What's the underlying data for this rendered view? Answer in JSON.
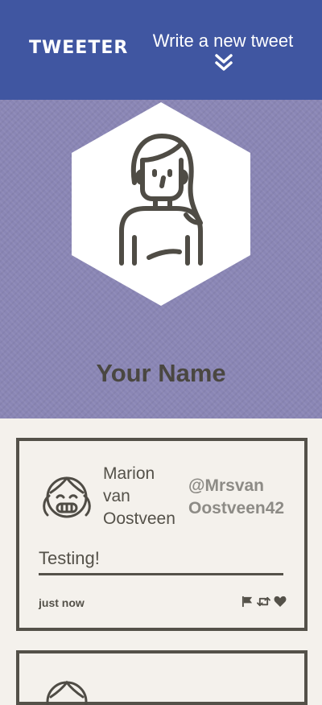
{
  "nav": {
    "brand": "TWEETER",
    "write_label": "Write a new tweet",
    "write_icon": "double-chevron-down-icon"
  },
  "profile": {
    "name": "Your Name",
    "avatar_icon": "woman-avatar-icon"
  },
  "tweets": [
    {
      "name": "Marion van Oostveen",
      "handle": "@Mrsvan Oostveen42",
      "avatar_icon": "girl-avatar-icon",
      "content": "Testing!",
      "time": "just now",
      "actions": [
        "flag-icon",
        "retweet-icon",
        "heart-icon"
      ]
    }
  ],
  "colors": {
    "nav": "#4056a1",
    "hero": "#8a86b5",
    "page": "#f4f1ec",
    "text": "#545149",
    "handle": "#8d8b86"
  }
}
